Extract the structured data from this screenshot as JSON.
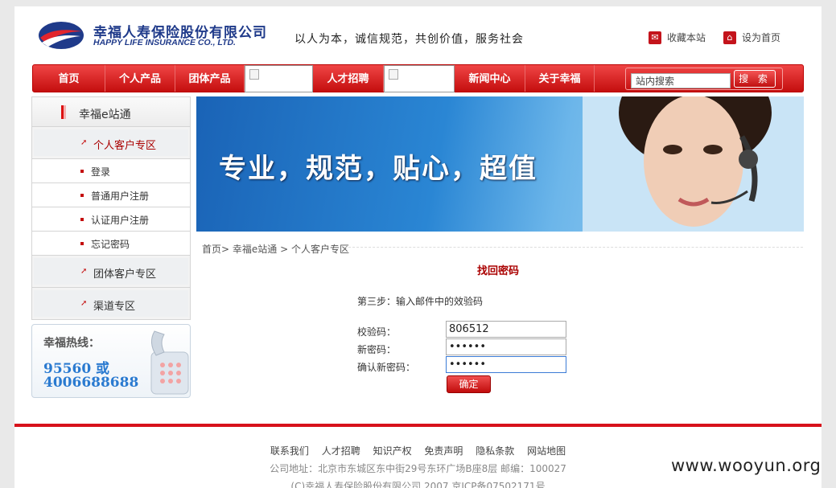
{
  "header": {
    "company_cn": "幸福人寿保险股份有限公司",
    "company_en": "HAPPY LIFE INSURANCE CO., LTD.",
    "slogan": "以人为本，诚信规范，共创价值，服务社会",
    "bookmark": "收藏本站",
    "set_home": "设为首页"
  },
  "nav": {
    "items": [
      "首页",
      "个人产品",
      "团体产品",
      "人才招聘",
      "新闻中心",
      "关于幸福"
    ],
    "search_placeholder": "站内搜索",
    "search_button": "搜 索"
  },
  "sidebar": {
    "title": "幸福e站通",
    "section_personal": "个人客户专区",
    "items": [
      "登录",
      "普通用户注册",
      "认证用户注册",
      "忘记密码"
    ],
    "section_group": "团体客户专区",
    "section_channel": "渠道专区",
    "hotline_label": "幸福热线：",
    "hotline_num1": "95560 或",
    "hotline_num2": "4006688688"
  },
  "banner": {
    "text": "专业，规范，贴心，超值"
  },
  "breadcrumb": [
    "首页",
    "幸福e站通",
    "个人客户专区"
  ],
  "form": {
    "title": "找回密码",
    "step": "第三步：输入邮件中的效验码",
    "code_label": "校验码：",
    "code_value": "806512",
    "newpw_label": "新密码：",
    "newpw_value": "••••••",
    "confirm_label": "确认新密码：",
    "confirm_value": "••••••",
    "submit": "确定"
  },
  "footer": {
    "links": [
      "联系我们",
      "人才招聘",
      "知识产权",
      "免责声明",
      "隐私条款",
      "网站地图"
    ],
    "address": "公司地址：北京市东城区东中街29号东环广场B座8层 邮编：100027",
    "copyright": "(C)幸福人寿保险股份有限公司 2007 京ICP备07502171号"
  },
  "watermark": "www.wooyun.org"
}
